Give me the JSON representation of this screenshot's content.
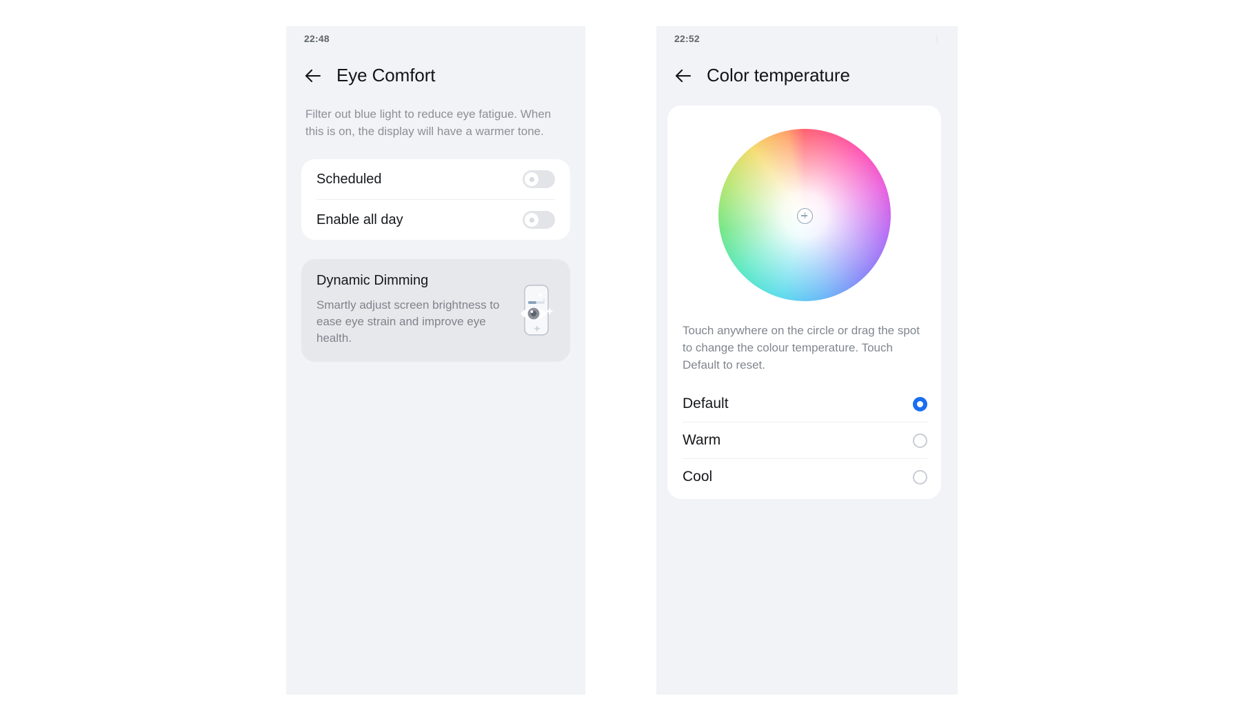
{
  "theme": {
    "panel_bg": "#f1f3f6",
    "card_bg": "#ffffff",
    "tinted_card_bg": "#e7e8ec",
    "accent_blue": "#1a6ef0",
    "title_text": "#131417",
    "muted_text": "#8b9097"
  },
  "eye_comfort": {
    "status": {
      "time": "22:48",
      "right_indicator": ""
    },
    "appbar": {
      "back_icon": "arrow-left-icon",
      "title": "Eye Comfort"
    },
    "description": "Filter out blue light to reduce eye fatigue. When this is on, the display will have a warmer tone.",
    "switch_rows": [
      {
        "label": "Scheduled",
        "state": "off"
      },
      {
        "label": "Enable all day",
        "state": "off"
      }
    ],
    "dynamic_dimming": {
      "title": "Dynamic Dimming",
      "subtitle": "Smartly adjust screen brightness to ease eye strain and improve eye health.",
      "illustration": "phone-brightness-eye-icon"
    }
  },
  "color_temperature": {
    "status": {
      "time": "22:52",
      "right_indicator": "❘"
    },
    "appbar": {
      "back_icon": "arrow-left-icon",
      "title": "Color temperature"
    },
    "wheel": {
      "name": "colour-temperature-wheel",
      "marker": "crosshair-marker-icon",
      "marker_position": "center"
    },
    "hint": "Touch anywhere on the circle or drag the spot to change the colour temperature. Touch Default to reset.",
    "options": [
      {
        "label": "Default",
        "selected": true
      },
      {
        "label": "Warm",
        "selected": false
      },
      {
        "label": "Cool",
        "selected": false
      }
    ]
  }
}
